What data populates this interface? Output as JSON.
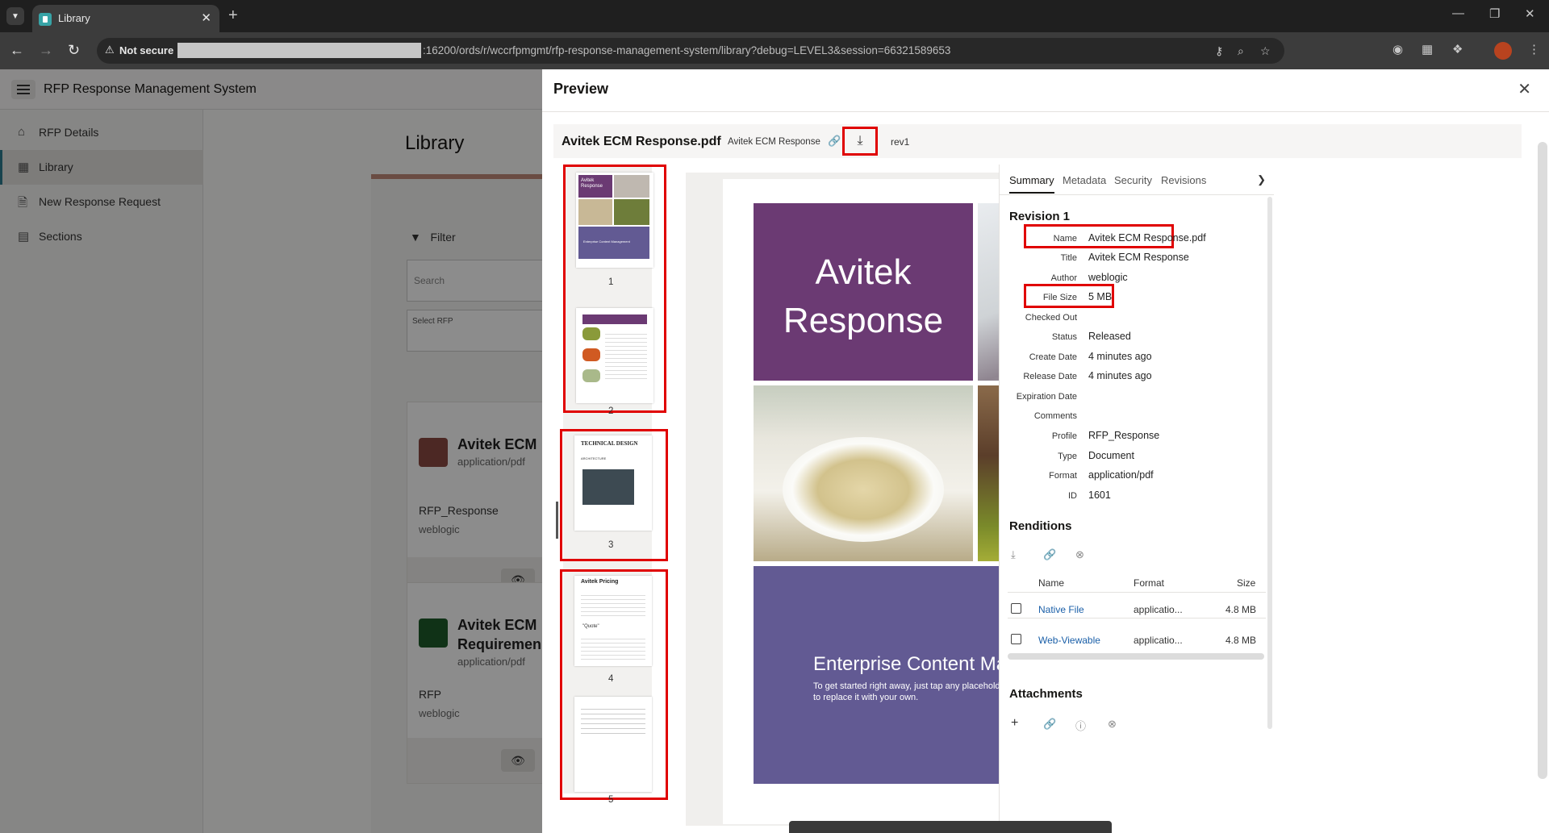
{
  "browser": {
    "tab_title": "Library",
    "not_secure_label": "Not secure",
    "url_visible": ":16200/ords/r/wccrfpmgmt/rfp-response-management-system/library?debug=LEVEL3&session=66321589653"
  },
  "app": {
    "title": "RFP Response Management System"
  },
  "sidebar": {
    "items": [
      {
        "label": "RFP Details",
        "icon": "home-icon"
      },
      {
        "label": "Library",
        "icon": "grid-icon",
        "active": true
      },
      {
        "label": "New Response Request",
        "icon": "new-doc-icon"
      },
      {
        "label": "Sections",
        "icon": "table-icon"
      }
    ]
  },
  "library": {
    "page_title": "Library",
    "filter_label": "Filter",
    "search_placeholder": "Search",
    "select_label": "Select RFP",
    "cards": [
      {
        "title": "Avitek ECM",
        "mime": "application/pdf",
        "profile": "RFP_Response",
        "author": "weblogic",
        "badge_color": "#8a4a42"
      },
      {
        "title": "Avitek ECM Requiremen",
        "mime": "application/pdf",
        "profile": "RFP",
        "author": "weblogic",
        "badge_color": "#1e5b2a"
      }
    ]
  },
  "preview": {
    "title": "Preview",
    "file_name": "Avitek ECM Response.pdf",
    "doc_title": "Avitek ECM Response",
    "revision": "rev1",
    "thumbnails": [
      {
        "num": "1"
      },
      {
        "num": "2"
      },
      {
        "num": "3"
      },
      {
        "num": "4"
      },
      {
        "num": "5"
      }
    ],
    "page": {
      "big_title_line1": "Avitek",
      "big_title_line2": "Response",
      "ecm_title": "Enterprise Content Management",
      "ecm_body": "To get started right away, just tap any placeholder text (such as this) and start typing to replace it with your own."
    },
    "thumb_texts": {
      "t1_title": "Avitek Response",
      "t1_footer": "Enterprise Content Management",
      "t3_title": "TECHNICAL DESIGN",
      "t3_sub": "ARCHITECTURE",
      "t4_title": "Avitek Pricing",
      "t4_quote": "\"Quote\""
    }
  },
  "details": {
    "tabs": [
      "Summary",
      "Metadata",
      "Security",
      "Revisions"
    ],
    "revision_title": "Revision 1",
    "properties": [
      {
        "label": "Name",
        "value": "Avitek ECM Response.pdf"
      },
      {
        "label": "Title",
        "value": "Avitek ECM Response"
      },
      {
        "label": "Author",
        "value": "weblogic"
      },
      {
        "label": "File Size",
        "value": "5 MB"
      },
      {
        "label": "Checked Out",
        "value": ""
      },
      {
        "label": "Status",
        "value": "Released"
      },
      {
        "label": "Create Date",
        "value": "4 minutes ago"
      },
      {
        "label": "Release Date",
        "value": "4 minutes ago"
      },
      {
        "label": "Expiration Date",
        "value": ""
      },
      {
        "label": "Comments",
        "value": ""
      },
      {
        "label": "Profile",
        "value": "RFP_Response"
      },
      {
        "label": "Type",
        "value": "Document"
      },
      {
        "label": "Format",
        "value": "application/pdf"
      },
      {
        "label": "ID",
        "value": "1601"
      }
    ],
    "renditions_title": "Renditions",
    "renditions_headers": {
      "name": "Name",
      "format": "Format",
      "size": "Size"
    },
    "renditions": [
      {
        "name": "Native File",
        "format": "applicatio...",
        "size": "4.8 MB"
      },
      {
        "name": "Web-Viewable",
        "format": "applicatio...",
        "size": "4.8 MB"
      }
    ],
    "attachments_title": "Attachments"
  },
  "colors": {
    "highlight": "#e00000",
    "title_tile": "#6b3a73",
    "bottom_tile": "#625a93",
    "link": "#1a5fa8"
  }
}
